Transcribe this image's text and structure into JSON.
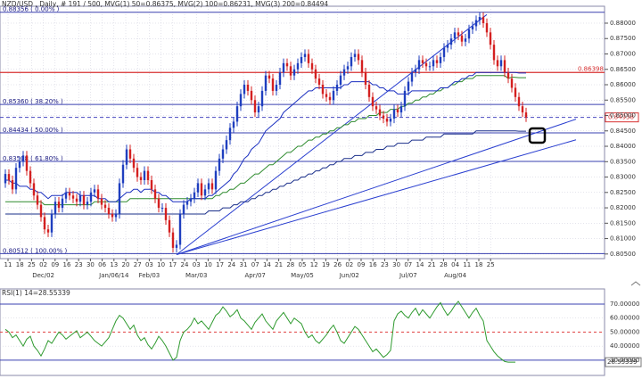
{
  "header": {
    "title": "NZD/USD , Daily, # 191 / 500, MVG(1) 50=0.86375, MVG(2) 100=0.86231, MVG(3) 200=0.84494"
  },
  "colors": {
    "bull_candle": "#1f3fbf",
    "bear_candle": "#d42020",
    "ma50": "#1a2fc0",
    "ma100": "#2e8b2e",
    "ma200": "#1a2f8a",
    "trendline": "#2a3fd0",
    "fib_line": "#3a40b0",
    "resistance": "#d83030",
    "current_price": "#4a4ac0",
    "rsi_line": "#2f9a2f",
    "rsi_mid": "#e04040",
    "rsi_bands": "#3a40b0",
    "grid": "#c8c8d8",
    "marker": "#000000"
  },
  "chart_data": [
    {
      "type": "candlestick",
      "title": "NZD/USD , Daily",
      "ylim": [
        0.8035,
        0.8855
      ],
      "yticks": [
        "0.88000",
        "0.87500",
        "0.87000",
        "0.86500",
        "0.86000",
        "0.85500",
        "0.85000",
        "0.84500",
        "0.84000",
        "0.83500",
        "0.83000",
        "0.82500",
        "0.82000",
        "0.81500",
        "0.81000",
        "0.80500"
      ],
      "xticks": [
        "11",
        "18",
        "25",
        "02",
        "09",
        "16",
        "23",
        "30",
        "06",
        "13",
        "20",
        "27",
        "03",
        "10",
        "17",
        "24",
        "03",
        "10",
        "17",
        "24",
        "31",
        "07",
        "14",
        "21",
        "28",
        "05",
        "12",
        "19",
        "26",
        "02",
        "09",
        "16",
        "23",
        "30",
        "07",
        "14",
        "21",
        "28",
        "04",
        "11",
        "18",
        "25"
      ],
      "month_labels": [
        "Dec/02",
        "Jan/06/14",
        "Feb/03",
        "Mar/03",
        "Apr/07",
        "May/05",
        "Jun/02",
        "Jul/07",
        "Aug/04"
      ],
      "close": [
        0.831,
        0.829,
        0.826,
        0.833,
        0.835,
        0.837,
        0.832,
        0.828,
        0.824,
        0.821,
        0.817,
        0.813,
        0.812,
        0.818,
        0.822,
        0.82,
        0.823,
        0.825,
        0.824,
        0.823,
        0.822,
        0.824,
        0.821,
        0.822,
        0.825,
        0.826,
        0.823,
        0.821,
        0.82,
        0.818,
        0.817,
        0.818,
        0.828,
        0.834,
        0.839,
        0.836,
        0.833,
        0.83,
        0.829,
        0.832,
        0.829,
        0.826,
        0.823,
        0.82,
        0.82,
        0.816,
        0.812,
        0.807,
        0.808,
        0.818,
        0.821,
        0.822,
        0.823,
        0.825,
        0.828,
        0.824,
        0.826,
        0.828,
        0.826,
        0.832,
        0.836,
        0.839,
        0.842,
        0.846,
        0.848,
        0.853,
        0.857,
        0.86,
        0.858,
        0.855,
        0.851,
        0.853,
        0.858,
        0.863,
        0.862,
        0.858,
        0.86,
        0.864,
        0.867,
        0.866,
        0.863,
        0.865,
        0.867,
        0.869,
        0.87,
        0.867,
        0.865,
        0.862,
        0.86,
        0.857,
        0.856,
        0.855,
        0.858,
        0.86,
        0.863,
        0.865,
        0.866,
        0.869,
        0.87,
        0.868,
        0.864,
        0.86,
        0.856,
        0.853,
        0.852,
        0.85,
        0.849,
        0.848,
        0.849,
        0.852,
        0.851,
        0.853,
        0.858,
        0.861,
        0.864,
        0.865,
        0.868,
        0.867,
        0.866,
        0.866,
        0.868,
        0.867,
        0.869,
        0.872,
        0.873,
        0.875,
        0.877,
        0.876,
        0.874,
        0.875,
        0.878,
        0.879,
        0.881,
        0.882,
        0.88,
        0.877,
        0.873,
        0.868,
        0.866,
        0.868,
        0.864,
        0.862,
        0.859,
        0.856,
        0.853,
        0.851,
        0.8494
      ],
      "open_first": 0.828,
      "ma50": [
        0.829,
        0.829,
        0.828,
        0.828,
        0.827,
        0.827,
        0.827,
        0.826,
        0.826,
        0.825,
        0.825,
        0.824,
        0.823,
        0.824,
        0.824,
        0.824,
        0.824,
        0.825,
        0.825,
        0.825,
        0.825,
        0.824,
        0.824,
        0.824,
        0.824,
        0.824,
        0.823,
        0.823,
        0.823,
        0.822,
        0.822,
        0.822,
        0.823,
        0.824,
        0.825,
        0.825,
        0.826,
        0.826,
        0.825,
        0.826,
        0.826,
        0.826,
        0.825,
        0.825,
        0.824,
        0.824,
        0.823,
        0.822,
        0.822,
        0.822,
        0.822,
        0.822,
        0.823,
        0.823,
        0.823,
        0.823,
        0.823,
        0.824,
        0.824,
        0.825,
        0.826,
        0.827,
        0.828,
        0.829,
        0.831,
        0.832,
        0.834,
        0.836,
        0.837,
        0.839,
        0.84,
        0.841,
        0.843,
        0.845,
        0.846,
        0.847,
        0.848,
        0.849,
        0.851,
        0.852,
        0.853,
        0.854,
        0.855,
        0.856,
        0.857,
        0.858,
        0.858,
        0.859,
        0.859,
        0.859,
        0.859,
        0.859,
        0.859,
        0.859,
        0.859,
        0.86,
        0.86,
        0.861,
        0.861,
        0.861,
        0.861,
        0.861,
        0.861,
        0.86,
        0.86,
        0.859,
        0.859,
        0.858,
        0.858,
        0.858,
        0.857,
        0.857,
        0.857,
        0.857,
        0.858,
        0.858,
        0.858,
        0.858,
        0.858,
        0.858,
        0.858,
        0.858,
        0.859,
        0.859,
        0.859,
        0.86,
        0.861,
        0.861,
        0.862,
        0.862,
        0.863,
        0.863,
        0.864,
        0.864,
        0.864,
        0.864,
        0.864,
        0.864,
        0.864,
        0.864,
        0.864,
        0.864,
        0.864,
        0.864,
        0.8638,
        0.8638,
        0.8638
      ],
      "ma100": [
        0.822,
        0.822,
        0.822,
        0.822,
        0.822,
        0.822,
        0.822,
        0.822,
        0.822,
        0.822,
        0.822,
        0.821,
        0.821,
        0.821,
        0.821,
        0.821,
        0.821,
        0.821,
        0.821,
        0.821,
        0.821,
        0.821,
        0.821,
        0.821,
        0.821,
        0.822,
        0.822,
        0.822,
        0.822,
        0.822,
        0.822,
        0.822,
        0.822,
        0.822,
        0.822,
        0.823,
        0.823,
        0.823,
        0.823,
        0.823,
        0.823,
        0.823,
        0.823,
        0.823,
        0.823,
        0.823,
        0.823,
        0.823,
        0.823,
        0.823,
        0.823,
        0.823,
        0.823,
        0.823,
        0.823,
        0.823,
        0.823,
        0.823,
        0.823,
        0.824,
        0.824,
        0.825,
        0.825,
        0.826,
        0.826,
        0.827,
        0.828,
        0.828,
        0.829,
        0.83,
        0.831,
        0.831,
        0.832,
        0.833,
        0.834,
        0.834,
        0.835,
        0.836,
        0.837,
        0.838,
        0.838,
        0.839,
        0.84,
        0.84,
        0.841,
        0.842,
        0.842,
        0.843,
        0.843,
        0.844,
        0.844,
        0.845,
        0.845,
        0.846,
        0.846,
        0.847,
        0.847,
        0.848,
        0.848,
        0.849,
        0.849,
        0.849,
        0.85,
        0.85,
        0.85,
        0.851,
        0.851,
        0.851,
        0.852,
        0.852,
        0.852,
        0.853,
        0.853,
        0.854,
        0.854,
        0.855,
        0.855,
        0.856,
        0.856,
        0.857,
        0.857,
        0.858,
        0.858,
        0.859,
        0.859,
        0.86,
        0.86,
        0.861,
        0.861,
        0.862,
        0.862,
        0.862,
        0.863,
        0.863,
        0.863,
        0.863,
        0.863,
        0.863,
        0.863,
        0.863,
        0.863,
        0.862,
        0.8625,
        0.8624,
        0.8623,
        0.8623,
        0.8623
      ],
      "ma200": [
        0.818,
        0.818,
        0.818,
        0.818,
        0.818,
        0.818,
        0.818,
        0.818,
        0.818,
        0.818,
        0.818,
        0.818,
        0.818,
        0.818,
        0.818,
        0.818,
        0.818,
        0.818,
        0.818,
        0.818,
        0.818,
        0.818,
        0.818,
        0.818,
        0.818,
        0.818,
        0.818,
        0.818,
        0.818,
        0.818,
        0.818,
        0.818,
        0.818,
        0.818,
        0.818,
        0.818,
        0.818,
        0.818,
        0.818,
        0.818,
        0.818,
        0.818,
        0.818,
        0.818,
        0.818,
        0.818,
        0.818,
        0.818,
        0.818,
        0.818,
        0.818,
        0.818,
        0.818,
        0.818,
        0.818,
        0.818,
        0.818,
        0.819,
        0.819,
        0.819,
        0.819,
        0.82,
        0.82,
        0.82,
        0.821,
        0.821,
        0.822,
        0.822,
        0.822,
        0.823,
        0.823,
        0.824,
        0.824,
        0.825,
        0.825,
        0.826,
        0.826,
        0.827,
        0.827,
        0.828,
        0.828,
        0.829,
        0.829,
        0.83,
        0.83,
        0.831,
        0.831,
        0.832,
        0.832,
        0.833,
        0.833,
        0.834,
        0.834,
        0.835,
        0.835,
        0.836,
        0.836,
        0.836,
        0.837,
        0.837,
        0.837,
        0.838,
        0.838,
        0.838,
        0.839,
        0.839,
        0.839,
        0.84,
        0.84,
        0.84,
        0.841,
        0.841,
        0.841,
        0.841,
        0.842,
        0.842,
        0.842,
        0.842,
        0.843,
        0.843,
        0.843,
        0.843,
        0.843,
        0.844,
        0.844,
        0.844,
        0.844,
        0.844,
        0.844,
        0.844,
        0.844,
        0.844,
        0.845,
        0.845,
        0.845,
        0.845,
        0.845,
        0.845,
        0.845,
        0.845,
        0.845,
        0.845,
        0.845,
        0.845,
        0.8449,
        0.8449,
        0.8449
      ],
      "trendlines": [
        {
          "x": [
            48,
            135
          ],
          "y": [
            0.8048,
            0.8828
          ]
        },
        {
          "x": [
            48,
            160
          ],
          "y": [
            0.8048,
            0.8488
          ]
        },
        {
          "x": [
            48,
            160
          ],
          "y": [
            0.8048,
            0.8421
          ]
        }
      ],
      "fib_levels": [
        {
          "label": "0.88356 ( 0.00% )",
          "value": 0.88356
        },
        {
          "label": "0.85360 ( 38.20% )",
          "value": 0.8536
        },
        {
          "label": "0.84434 ( 50.00% )",
          "value": 0.84434
        },
        {
          "label": "0.83508 ( 61.80% )",
          "value": 0.83508
        },
        {
          "label": "0.80512 ( 100.00% )",
          "value": 0.80512
        }
      ],
      "horizontal_lines": [
        {
          "label": "0.86398",
          "value": 0.86398,
          "role": "resistance"
        },
        {
          "label": "0.84938",
          "value": 0.84938,
          "role": "current"
        }
      ],
      "marker_value": 0.8435
    },
    {
      "type": "line",
      "title": "RSI(1) 14=28.55339",
      "ylim": [
        21,
        77
      ],
      "yticks": [
        "70.00000",
        "60.00000",
        "50.00000",
        "40.00000",
        "30.00000"
      ],
      "current_label": "28.55339",
      "rsi": [
        52,
        50,
        46,
        48,
        44,
        40,
        45,
        47,
        40,
        37,
        33,
        38,
        44,
        42,
        46,
        50,
        48,
        45,
        47,
        49,
        51,
        46,
        48,
        50,
        47,
        44,
        42,
        40,
        43,
        46,
        52,
        58,
        62,
        60,
        56,
        52,
        55,
        48,
        44,
        46,
        41,
        38,
        42,
        47,
        44,
        40,
        35,
        30,
        32,
        44,
        50,
        52,
        55,
        60,
        56,
        58,
        55,
        52,
        57,
        62,
        64,
        68,
        65,
        61,
        63,
        66,
        60,
        58,
        55,
        52,
        57,
        60,
        63,
        58,
        55,
        52,
        58,
        61,
        64,
        60,
        56,
        60,
        58,
        56,
        50,
        46,
        48,
        44,
        42,
        45,
        48,
        52,
        55,
        50,
        44,
        42,
        46,
        50,
        54,
        52,
        48,
        44,
        40,
        36,
        38,
        35,
        32,
        34,
        37,
        58,
        63,
        65,
        62,
        60,
        64,
        67,
        62,
        66,
        63,
        60,
        64,
        68,
        71,
        66,
        62,
        65,
        69,
        72,
        68,
        64,
        60,
        64,
        67,
        62,
        58,
        44,
        40,
        36,
        33,
        31,
        29,
        28.6,
        28.6,
        28.55339
      ]
    }
  ]
}
